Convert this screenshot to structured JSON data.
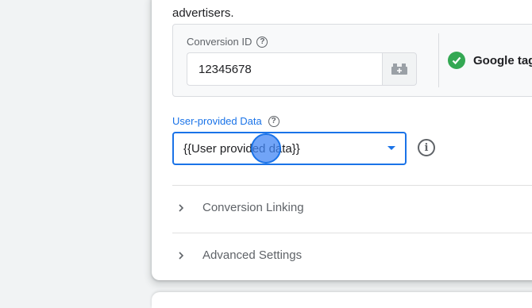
{
  "intro_text": "advertisers.",
  "conversion": {
    "label": "Conversion ID",
    "value": "12345678",
    "help_icon": "question-circle-icon",
    "variable_icon": "variable-brick-icon"
  },
  "google_tag": {
    "status_icon": "check-circle-icon",
    "label": "Google tag"
  },
  "user_provided_data": {
    "label": "User-provided Data",
    "selected": "{{User provided data}}",
    "help_icon": "question-circle-icon",
    "info_icon": "info-icon",
    "info_glyph": "i",
    "help_glyph": "?"
  },
  "sections": [
    {
      "label": "Conversion Linking",
      "icon": "chevron-right-icon"
    },
    {
      "label": "Advanced Settings",
      "icon": "chevron-right-icon"
    }
  ],
  "colors": {
    "accent": "#1a73e8",
    "success": "#34a853",
    "text_primary": "#202124",
    "text_secondary": "#5f6368"
  }
}
